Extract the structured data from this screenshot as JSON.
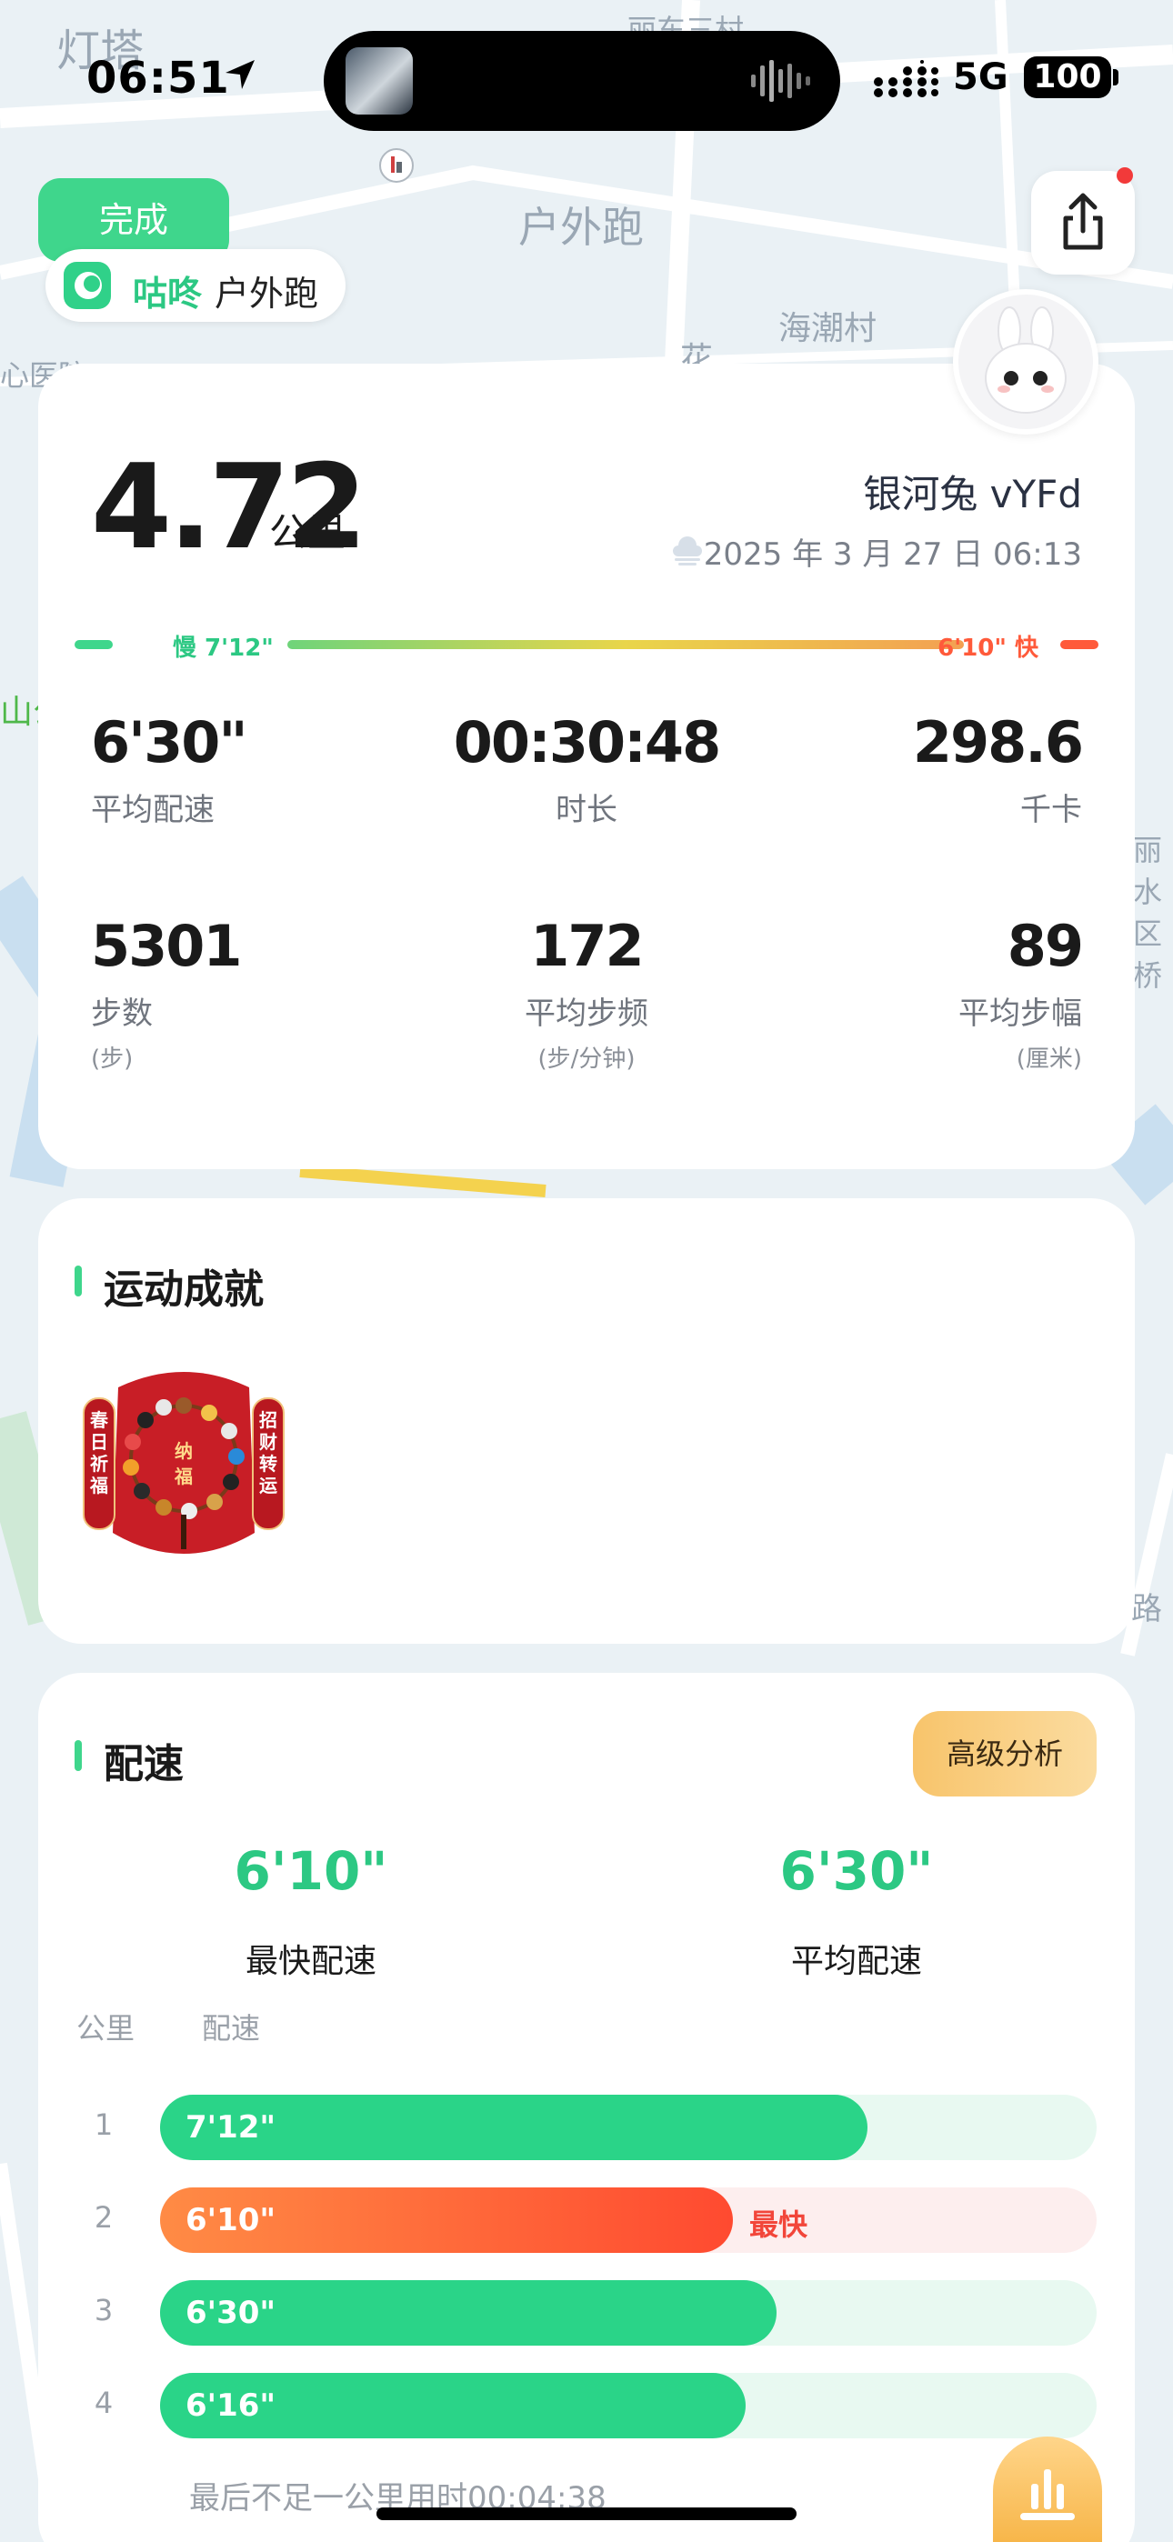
{
  "map": {
    "labels": [
      "灯塔",
      "户外跑",
      "海潮村",
      "心医院",
      "花",
      "山公",
      "丽水区桥",
      "路",
      "丽东三村"
    ]
  },
  "status_bar": {
    "time": "06:51",
    "network": "5G",
    "battery": "100"
  },
  "top": {
    "done_label": "完成",
    "brand_name": "咕咚",
    "brand_sub": "户外跑"
  },
  "summary": {
    "distance": "4.72",
    "distance_unit": "公里",
    "username": "银河兔 vYFd",
    "datetime": "2025 年 3 月 27 日 06:13",
    "pace_slow_label": "慢 7'12\"",
    "pace_fast_label": "6'10\" 快",
    "stats": [
      {
        "value": "6'30\"",
        "label": "平均配速",
        "unit": ""
      },
      {
        "value": "00:30:48",
        "label": "时长",
        "unit": ""
      },
      {
        "value": "298.6",
        "label": "千卡",
        "unit": ""
      },
      {
        "value": "5301",
        "label": "步数",
        "unit": "(步)"
      },
      {
        "value": "172",
        "label": "平均步频",
        "unit": "(步/分钟)"
      },
      {
        "value": "89",
        "label": "平均步幅",
        "unit": "(厘米)"
      }
    ]
  },
  "achievements": {
    "title": "运动成就",
    "badge_text_left": "春日祈福",
    "badge_text_center": "纳福",
    "badge_text_right": "招财转运"
  },
  "pace": {
    "title": "配速",
    "advanced_label": "高级分析",
    "fastest_value": "6'10\"",
    "fastest_label": "最快配速",
    "average_value": "6'30\"",
    "average_label": "平均配速",
    "col_km": "公里",
    "col_pace": "配速",
    "splits": [
      {
        "km": "1",
        "pace": "7'12\"",
        "fill": 0.755,
        "fastest": false,
        "tag": ""
      },
      {
        "km": "2",
        "pace": "6'10\"",
        "fill": 0.612,
        "fastest": true,
        "tag": "最快"
      },
      {
        "km": "3",
        "pace": "6'30\"",
        "fill": 0.658,
        "fastest": false,
        "tag": ""
      },
      {
        "km": "4",
        "pace": "6'16\"",
        "fill": 0.625,
        "fastest": false,
        "tag": ""
      }
    ],
    "last_note": "最后不足一公里用时00:04:38"
  },
  "colors": {
    "accent_green": "#3fd68c",
    "fast_red": "#ff4a30",
    "advanced_gold": "#f8c46b"
  }
}
